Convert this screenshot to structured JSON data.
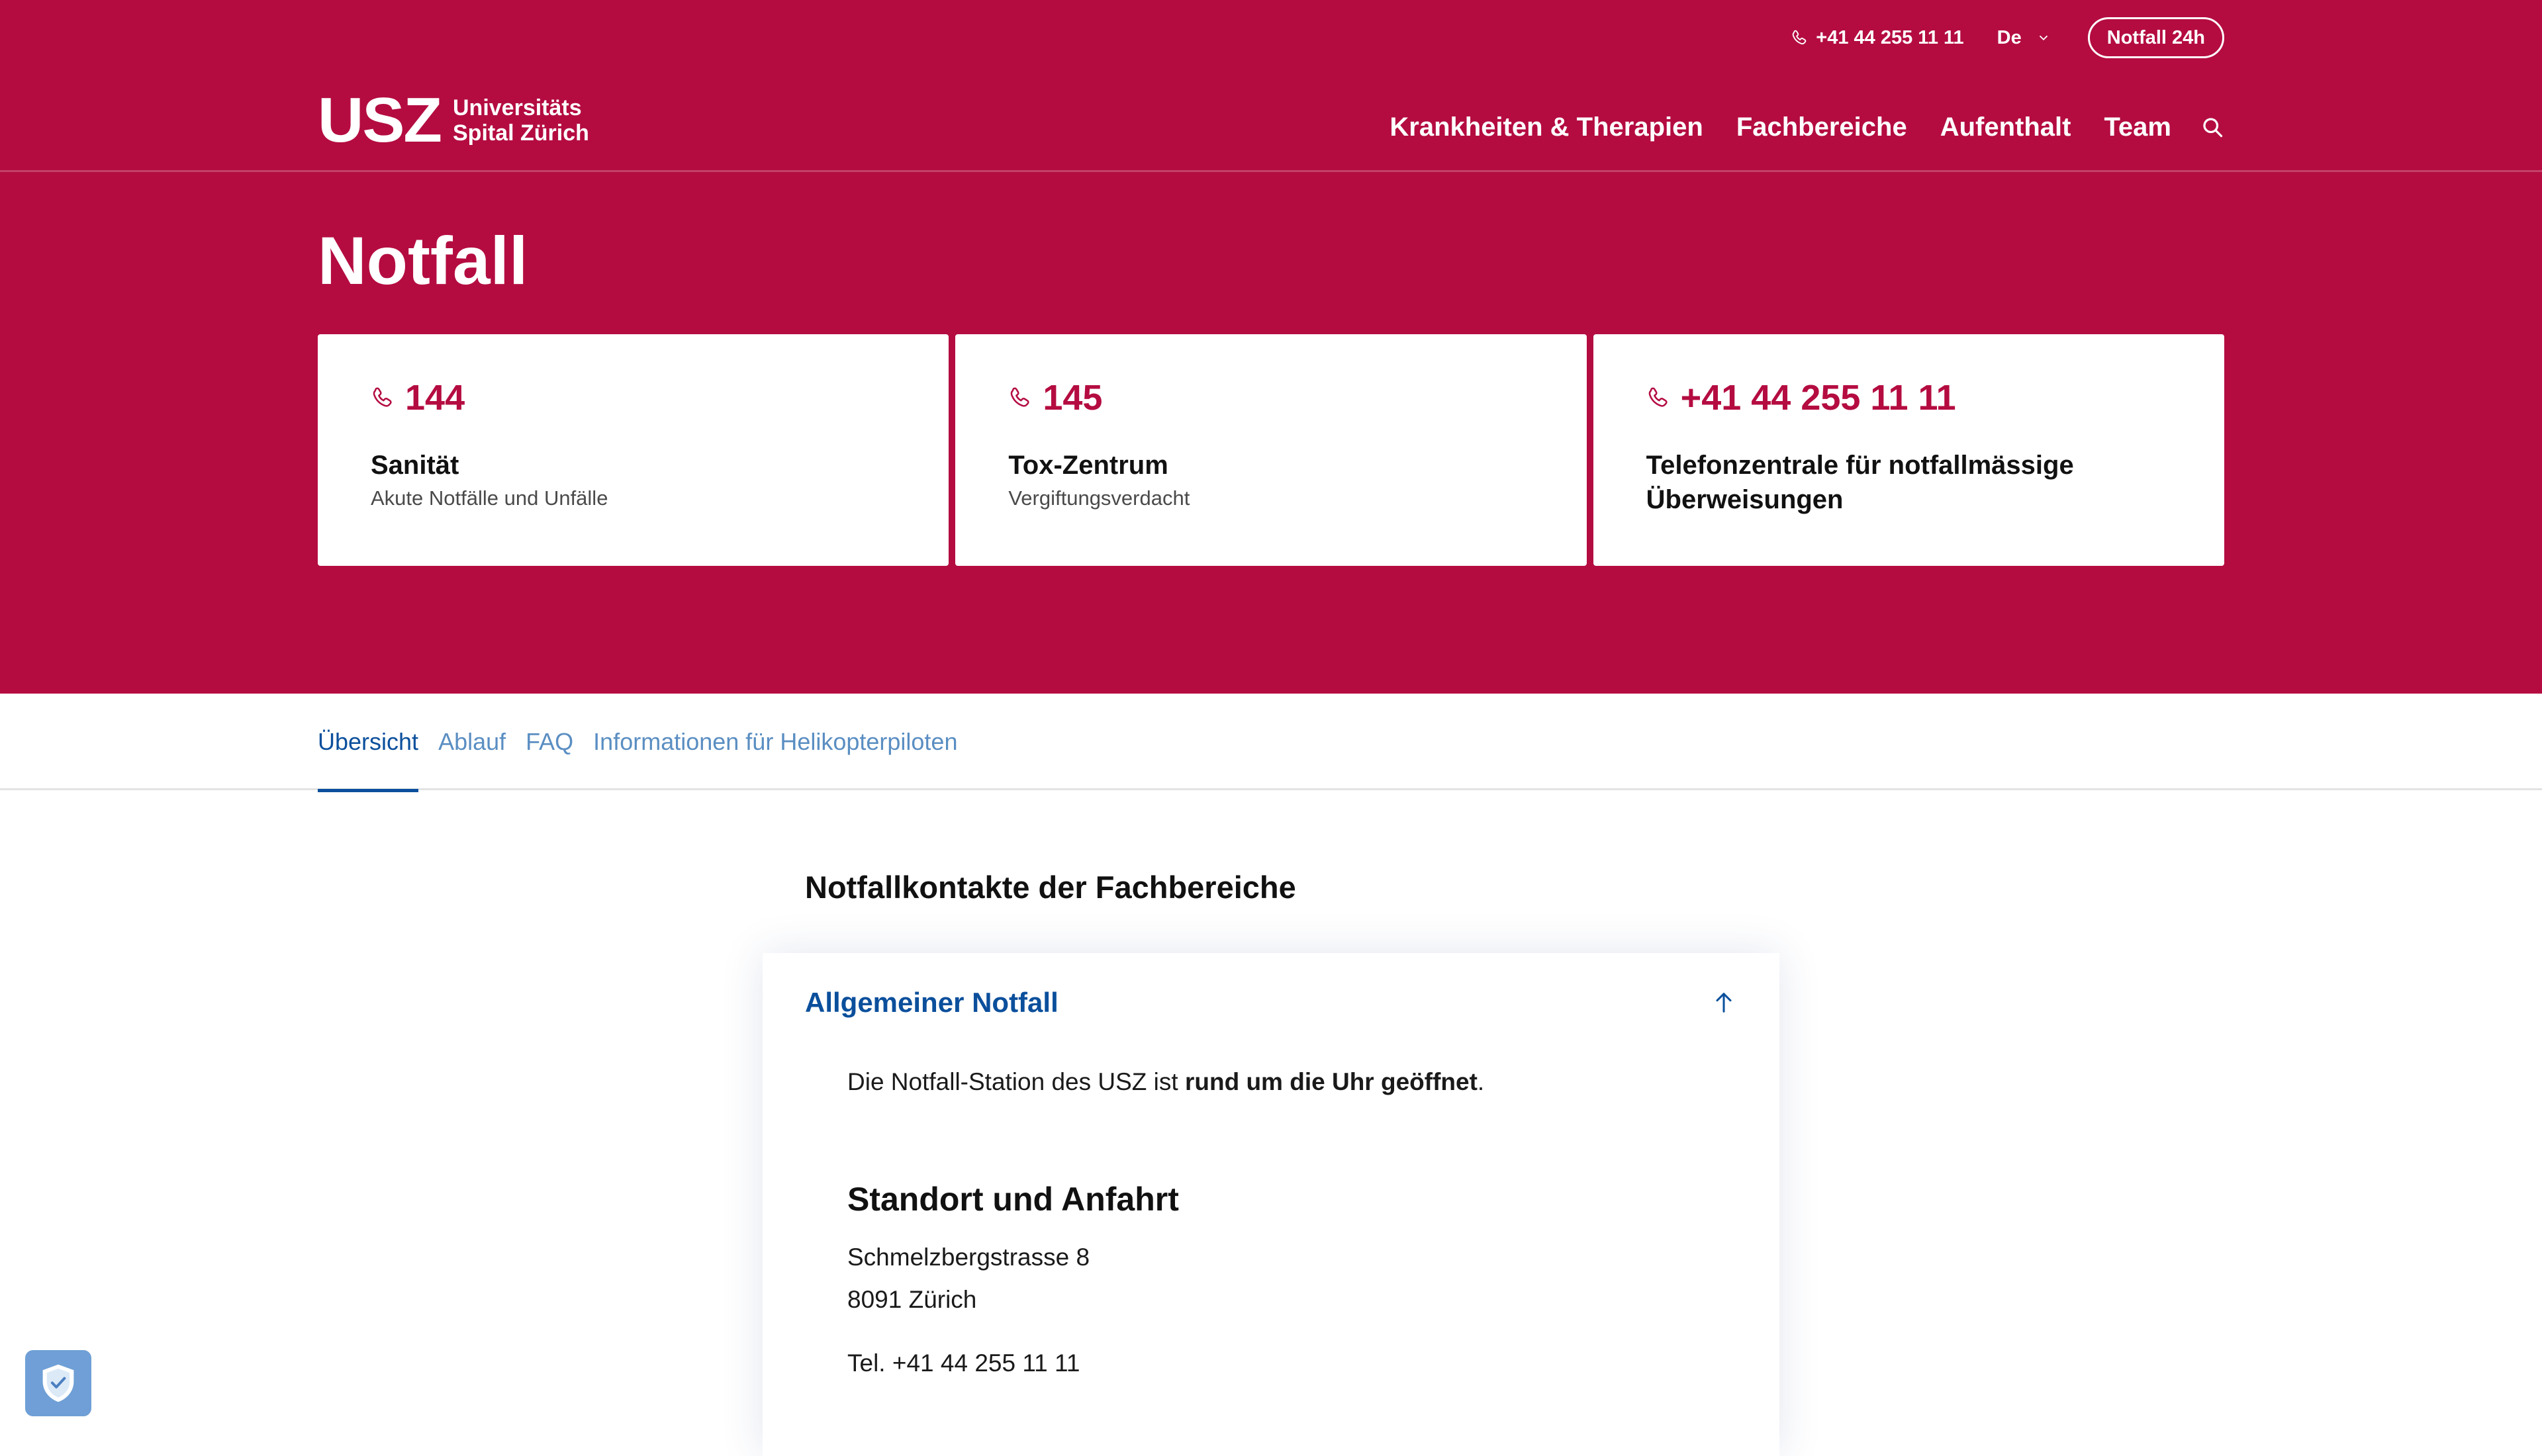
{
  "header": {
    "phone": "+41 44 255 11 11",
    "language": "De",
    "emergency_button": "Notfall 24h",
    "logo": {
      "mark": "USZ",
      "line1": "Universitäts",
      "line2": "Spital Zürich"
    },
    "nav": [
      "Krankheiten & Therapien",
      "Fachbereiche",
      "Aufenthalt",
      "Team"
    ]
  },
  "page": {
    "title": "Notfall"
  },
  "cards": [
    {
      "number": "144",
      "title": "Sanität",
      "subtitle": "Akute Notfälle und Unfälle"
    },
    {
      "number": "145",
      "title": "Tox-Zentrum",
      "subtitle": "Vergiftungsverdacht"
    },
    {
      "number": "+41 44 255 11 11",
      "title": "Telefonzentrale für notfallmässige Überweisungen",
      "subtitle": ""
    }
  ],
  "tabs": [
    "Übersicht",
    "Ablauf",
    "FAQ",
    "Informationen für Helikopterpiloten"
  ],
  "content": {
    "section_title": "Notfallkontakte der Fachbereiche",
    "accordion": {
      "title": "Allgemeiner Notfall",
      "intro_prefix": "Die Notfall-Station des USZ ist ",
      "intro_bold": "rund um die Uhr geöffnet",
      "intro_suffix": ".",
      "heading": "Standort und Anfahrt",
      "street": "Schmelzbergstrasse 8",
      "city": "8091 Zürich",
      "tel": "Tel. +41 44 255 11 11"
    }
  },
  "colors": {
    "brand": "#b40c41",
    "link": "#0b4f9c",
    "tab_inactive": "#5a8ec2"
  },
  "icons": {
    "phone": "phone-icon",
    "chevron": "chevron-down-icon",
    "search": "search-icon",
    "arrow_up": "arrow-up-icon",
    "privacy": "shield-check-icon"
  }
}
